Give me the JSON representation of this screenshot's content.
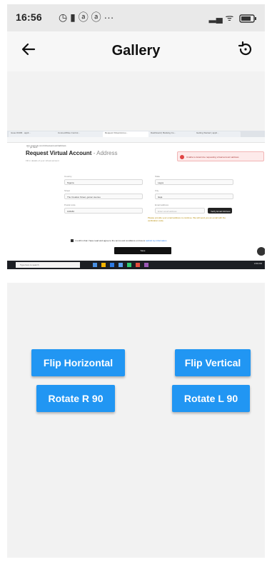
{
  "status_bar": {
    "time": "16:56",
    "left_icons": "◷ ▮ ⓐ ⓐ ···",
    "right_icons": "▂▄ ᯤ"
  },
  "app_bar": {
    "title": "Gallery",
    "back_icon": "arrow-left-icon",
    "action_icon": "rotate-reset-icon"
  },
  "image": {
    "tabs": [
      "Issue #1396 · appli...",
      "ConnectWise Control...",
      "Request Virtual Accou...",
      "Dashboard | Banking Co...",
      "Getting Started | appli..."
    ],
    "url": "app.example.com/virtual-account/address",
    "breadcrumb": "← go back",
    "page_title": "Request Virtual Account",
    "page_title_separator": " - ",
    "page_subtitle": "Address",
    "page_desc": "Fill in details of your virtual account",
    "alert_text": "Unable to determine requesting virtual account address",
    "fields": [
      {
        "label": "Country",
        "value": "Nigeria"
      },
      {
        "label": "State",
        "value": "Lagos"
      },
      {
        "label": "Street",
        "value": "The Creative Street, gamer avenue"
      },
      {
        "label": "City",
        "value": "Ikeja"
      },
      {
        "label": "Postal code",
        "value": "100182"
      },
      {
        "label": "Email address",
        "value": "Enter email address"
      }
    ],
    "verify_button": "Verify Email Address",
    "note_text": "Please provide your email address to continue. We will send you an email with the verification code.",
    "checkbox_text": "I confirm that I have read and agree to the terms and conditions on how to",
    "checkbox_link": "submit my information",
    "save_button": "Save",
    "taskbar_search": "Type here to search",
    "taskbar_clock": "4:56 PM"
  },
  "buttons": {
    "flip_horizontal": "Flip Horizontal",
    "flip_vertical": "Flip Vertical",
    "rotate_right": "Rotate R 90",
    "rotate_left": "Rotate L 90"
  },
  "colors": {
    "accent": "#2196f3",
    "background": "#f2f2f2"
  }
}
